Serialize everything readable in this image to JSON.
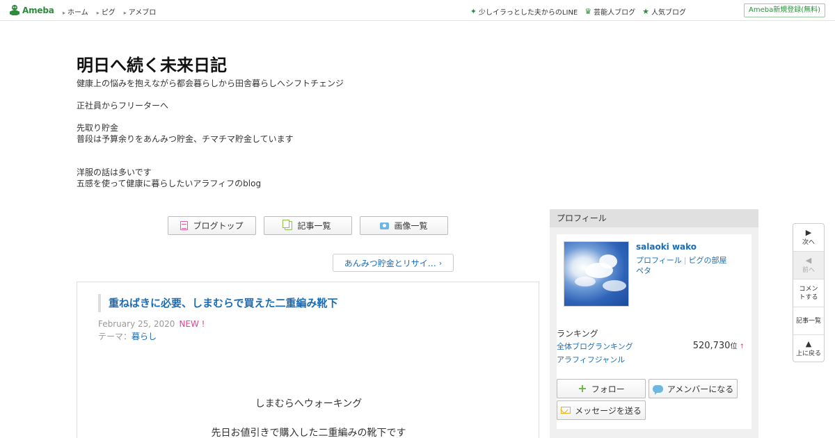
{
  "topbar": {
    "logo_text": "Ameba",
    "nav": [
      "ホーム",
      "ピグ",
      "アメブロ"
    ],
    "links": [
      {
        "icon": "sparkle-icon",
        "label": "少しイラっとした夫からのLINE"
      },
      {
        "icon": "crown-icon",
        "label": "芸能人ブログ"
      },
      {
        "icon": "star-icon",
        "label": "人気ブログ"
      }
    ],
    "register": "Ameba新規登録(無料)"
  },
  "blog": {
    "title": "明日へ続く未来日記",
    "description": [
      "健康上の悩みを抱えながら都会暮らしから田舎暮らしへシフトチェンジ",
      "",
      "正社員からフリーターへ",
      "",
      "先取り貯金",
      "普段は予算余りをあんみつ貯金、チマチマ貯金しています",
      "",
      "",
      "洋服の話は多いです",
      "五感を使って健康に暮らしたいアラフィフのblog"
    ]
  },
  "navbuttons": {
    "top": "ブログトップ",
    "list": "記事一覧",
    "images": "画像一覧"
  },
  "theme_pill": "あんみつ貯金とリサイ…",
  "article": {
    "title": "重ねばきに必要、しまむらで買えた二重編み靴下",
    "date": "February 25, 2020",
    "new_badge": "NEW !",
    "theme_label": "テーマ：",
    "theme": "暮らし",
    "body": [
      "しまむらへウォーキング",
      "先日お値引きで購入した二重編みの靴下です"
    ]
  },
  "profile": {
    "header": "プロフィール",
    "name": "salaoki wako",
    "link_profile": "プロフィール",
    "link_room": "ピグの部屋",
    "link_peta": "ペタ",
    "ranking_label": "ランキング",
    "ranking_all": "全体ブログランキング",
    "ranking_genre": "アラフィフジャンル",
    "ranking_value": "520,730",
    "ranking_unit": "位",
    "ranking_arrow": "↑",
    "follow": "フォロー",
    "amember": "アメンバーになる",
    "message": "メッセージを送る"
  },
  "sidenav": {
    "next": "次へ",
    "prev": "前へ",
    "comment": "コメントする",
    "list": "記事一覧",
    "top": "上に戻る"
  },
  "colors": {
    "brand_green": "#2d8c3c",
    "link_blue": "#1a6cb5",
    "new_pink": "#e0458f"
  }
}
